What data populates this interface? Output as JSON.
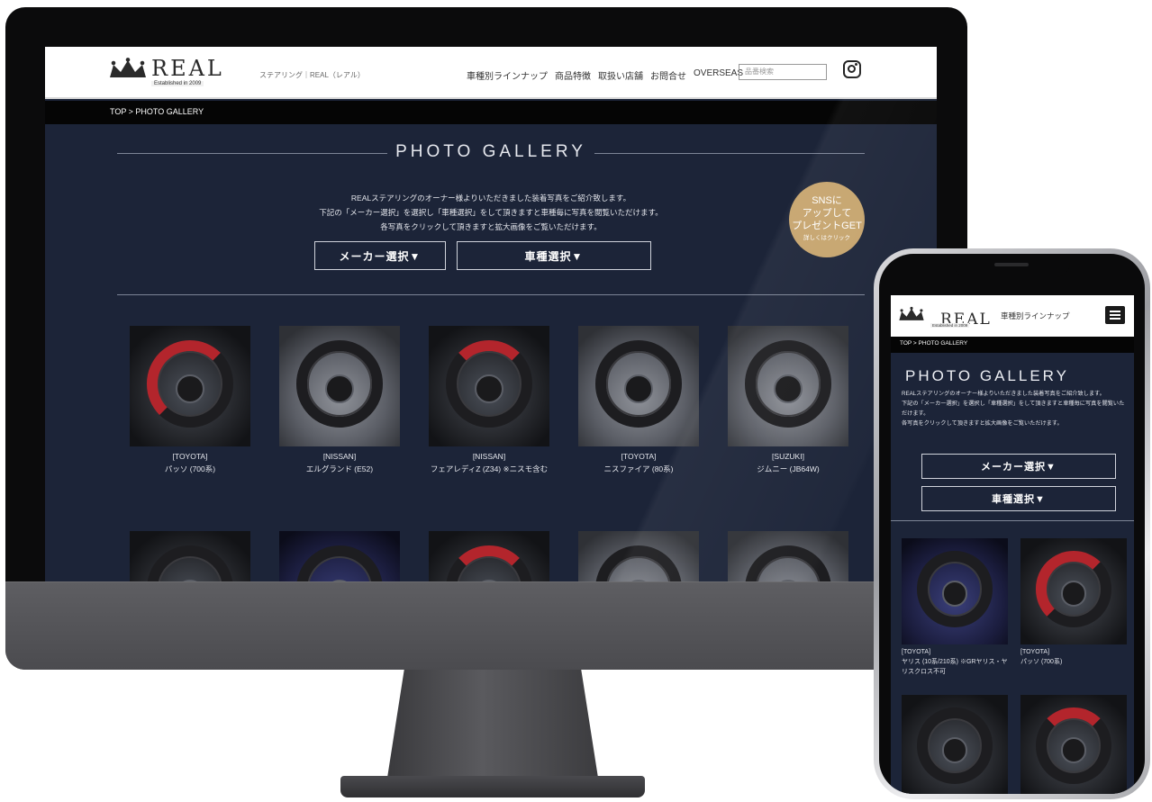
{
  "desktop": {
    "header": {
      "logo_text": "REAL",
      "logo_sub": "Established in 2009",
      "tagline": "ステアリング｜REAL（レアル）",
      "nav": [
        "車種別ラインナップ",
        "商品特徴",
        "取扱い店舗",
        "お問合せ",
        "OVERSEAS"
      ],
      "search_placeholder": "品番検索"
    },
    "breadcrumb": "TOP > PHOTO GALLERY",
    "page_title": "PHOTO GALLERY",
    "intro": [
      "REALステアリングのオーナー様よりいただきました装着写真をご紹介致します。",
      "下記の「メーカー選択」を選択し「車種選択」をして頂きますと車種毎に写真を閲覧いただけます。",
      "各写真をクリックして頂きますと拡大画像をご覧いただけます。"
    ],
    "buttons": {
      "maker": "メーカー選択▼",
      "car": "車種選択▼"
    },
    "sns_badge": {
      "line1": "SNSに",
      "line2": "アップして",
      "line3": "プレゼントGET",
      "sub": "詳しくはクリック"
    },
    "gallery": [
      {
        "maker": "[TOYOTA]",
        "model": "パッソ (700系)"
      },
      {
        "maker": "[NISSAN]",
        "model": "エルグランド (E52)"
      },
      {
        "maker": "[NISSAN]",
        "model": "フェアレディZ (Z34) ※ニスモ含む"
      },
      {
        "maker": "[TOYOTA]",
        "model": "ニスファイア (80系)"
      },
      {
        "maker": "[SUZUKI]",
        "model": "ジムニー (JB64W)"
      },
      {
        "maker": "",
        "model": ""
      },
      {
        "maker": "",
        "model": ""
      },
      {
        "maker": "",
        "model": ""
      },
      {
        "maker": "",
        "model": ""
      },
      {
        "maker": "",
        "model": ""
      }
    ]
  },
  "mobile": {
    "header": {
      "logo_text": "REAL",
      "logo_sub": "Established in 2009",
      "nav_link": "車種別ラインナップ"
    },
    "breadcrumb": "TOP > PHOTO GALLERY",
    "page_title": "PHOTO GALLERY",
    "intro": [
      "REALステアリングのオーナー様よりいただきました装着写真をご紹介致します。",
      "下記の「メーカー選択」を選択し「車種選択」をして頂きますと車種毎に写真を閲覧いただけます。",
      "各写真をクリックして頂きますと拡大画像をご覧いただけます。"
    ],
    "buttons": {
      "maker": "メーカー選択▼",
      "car": "車種選択▼"
    },
    "gallery": [
      {
        "maker": "[TOYOTA]",
        "model": "ヤリス (10系/210系) ※GRヤリス・ヤリスクロス不可"
      },
      {
        "maker": "[TOYOTA]",
        "model": "パッソ (700系)"
      },
      {
        "maker": "",
        "model": ""
      },
      {
        "maker": "",
        "model": ""
      }
    ]
  },
  "colors": {
    "page_bg": "#1c2438",
    "badge": "#c6a46d",
    "accent_red": "#b3252c"
  }
}
